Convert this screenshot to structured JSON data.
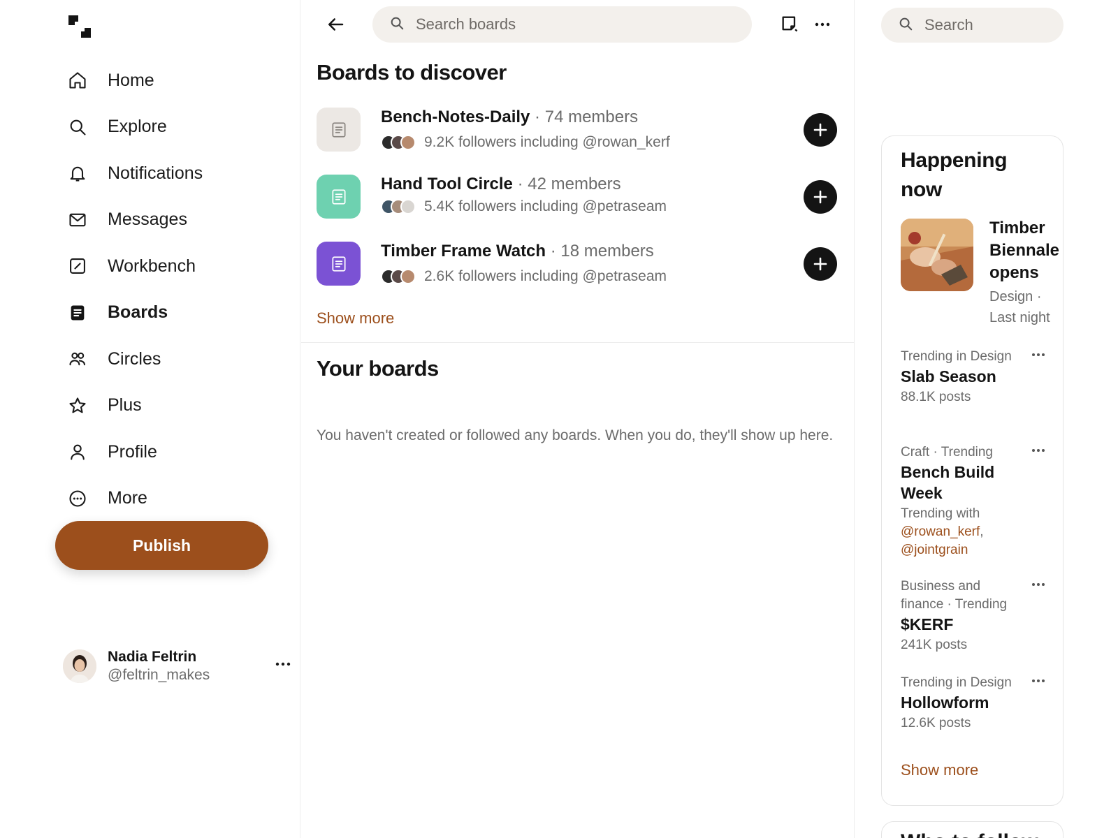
{
  "nav": {
    "items": [
      {
        "label": "Home",
        "icon": "home-icon"
      },
      {
        "label": "Explore",
        "icon": "search-icon"
      },
      {
        "label": "Notifications",
        "icon": "bell-icon"
      },
      {
        "label": "Messages",
        "icon": "envelope-icon"
      },
      {
        "label": "Workbench",
        "icon": "slash-square-icon"
      },
      {
        "label": "Boards",
        "icon": "boards-icon",
        "active": true
      },
      {
        "label": "Circles",
        "icon": "people-icon"
      },
      {
        "label": "Plus",
        "icon": "star-icon"
      },
      {
        "label": "Profile",
        "icon": "person-icon"
      },
      {
        "label": "More",
        "icon": "more-circle-icon"
      }
    ],
    "publish_label": "Publish"
  },
  "account": {
    "name": "Nadia Feltrin",
    "handle": "@feltrin_makes"
  },
  "main": {
    "search_placeholder": "Search boards",
    "discover_heading": "Boards to discover",
    "boards": [
      {
        "name": "Bench-Notes-Daily",
        "separator": "·",
        "members": "74 members",
        "followers": "9.2K followers including @rowan_kerf",
        "tile_color": "#ece8e4",
        "icon_color": "#8a8580"
      },
      {
        "name": "Hand Tool Circle",
        "separator": "·",
        "members": "42 members",
        "followers": "5.4K followers including @petraseam",
        "tile_color": "#6ed1b0",
        "icon_color": "#ffffff"
      },
      {
        "name": "Timber Frame Watch",
        "separator": "·",
        "members": "18 members",
        "followers": "2.6K followers including @petraseam",
        "tile_color": "#7b52d4",
        "icon_color": "#ffffff"
      }
    ],
    "show_more": "Show more",
    "your_heading": "Your boards",
    "empty_message": "You haven't created or followed any boards. When you do, they'll show up here."
  },
  "side": {
    "search_placeholder": "Search",
    "happening": {
      "heading": "Happening now",
      "featured": {
        "title": "Timber Biennale opens",
        "meta": "Design · Last night"
      },
      "trends": [
        {
          "context": "Trending in Design",
          "title": "Slab Season",
          "count": "88.1K posts"
        },
        {
          "context": "Craft · Trending",
          "title": "Bench Build Week",
          "count_prefix": "Trending with ",
          "mention_1": "@rowan_kerf",
          "mention_sep": ", ",
          "mention_2": "@jointgrain"
        },
        {
          "context": "Business and finance · Trending",
          "title": "$KERF",
          "count": "241K posts"
        },
        {
          "context": "Trending in Design",
          "title": "Hollowform",
          "count": "12.6K posts"
        }
      ],
      "show_more": "Show more"
    },
    "follow_heading": "Who to follow"
  },
  "colors": {
    "accent": "#9c4f1c",
    "text": "#141414",
    "muted": "#6b6b6b",
    "search_bg": "#f3f0ec"
  }
}
